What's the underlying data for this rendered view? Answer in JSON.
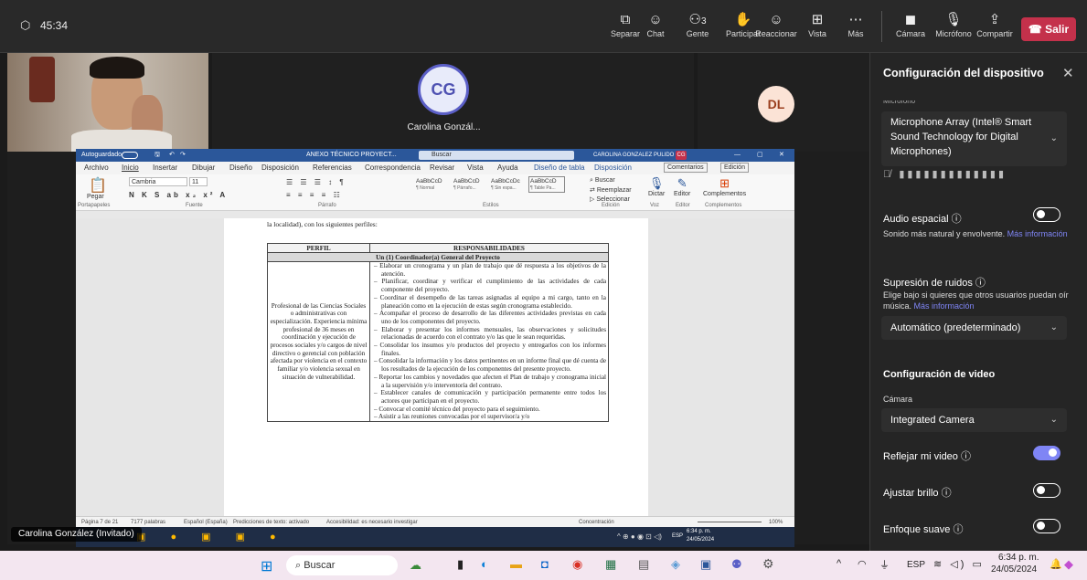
{
  "meeting": {
    "timer": "45:34",
    "toolbar": [
      {
        "label": "Separar",
        "icon": "popout-icon"
      },
      {
        "label": "Chat",
        "icon": "chat-icon"
      },
      {
        "label": "Gente",
        "icon": "people-icon",
        "count": "3"
      },
      {
        "label": "Participar",
        "icon": "hand-icon"
      },
      {
        "label": "Reaccionar",
        "icon": "smile-icon"
      },
      {
        "label": "Vista",
        "icon": "grid-icon"
      },
      {
        "label": "Más",
        "icon": "more-icon"
      }
    ],
    "camera_label": "Cámara",
    "mic_label": "Micrófono",
    "share_label": "Compartir",
    "leave_label": "Salir"
  },
  "participants": {
    "cg_initials": "CG",
    "cg_name": "Carolina Gonzál...",
    "dl_initials": "DL",
    "presenter": "Carolina González (Invitado)"
  },
  "word": {
    "autosave": "Autoguardado",
    "doc_title": "ANEXO TÉCNICO PROYECT...",
    "search": "Buscar",
    "user": "CAROLINA GONZALEZ PULIDO",
    "user_initials": "CG",
    "menu": [
      "Archivo",
      "Inicio",
      "Insertar",
      "Dibujar",
      "Diseño",
      "Disposición",
      "Referencias",
      "Correspondencia",
      "Revisar",
      "Vista",
      "Ayuda",
      "Diseño de tabla",
      "Disposición"
    ],
    "comments": "Comentarios",
    "editing": "Edición",
    "font_name": "Cambria",
    "font_size": "11",
    "styles": [
      "AaBbCcD",
      "AaBbCcD",
      "AaBbCcDc",
      "AaBbCcD"
    ],
    "style_names": [
      "¶ Normal",
      "¶ Párrafo...",
      "¶ Sin espa...",
      "¶ Table Pa..."
    ],
    "groups": [
      "Portapapeles",
      "Fuente",
      "Párrafo",
      "Estilos",
      "Edición",
      "Voz",
      "Editor",
      "Complementos"
    ],
    "find": "Buscar",
    "replace": "Reemplazar",
    "select": "Seleccionar",
    "dictate": "Dictar",
    "editor": "Editor",
    "addins": "Complementos",
    "paste": "Pegar",
    "intro": "la localidad), con los siguientes perfiles:",
    "th_perfil": "PERFIL",
    "th_resp": "RESPONSABILIDADES",
    "subheader": "Un (1) Coordinador(a) General del Proyecto",
    "perfil": "Profesional de las Ciencias Sociales o administrativas con especialización. Experiencia mínima profesional de 36 meses en coordinación y ejecución de procesos sociales y/o cargos de nivel directivo o gerencial con población afectada por violencia en el contexto familiar y/o violencia sexual en situación de vulnerabilidad.",
    "responsibilities": [
      "Elaborar un cronograma y un plan de trabajo que dé respuesta a los objetivos de la atención.",
      "Planificar, coordinar y verificar el cumplimiento de las actividades de cada componente del proyecto.",
      "Coordinar el desempeño de las tareas asignadas al equipo a mi cargo, tanto en la planeación como en la ejecución de estas según cronograma establecido.",
      "Acompañar el proceso de desarrollo de las diferentes actividades previstas en cada uno de los componentes del proyecto.",
      "Elaborar y presentar los informes mensuales, las observaciones y solicitudes relacionadas de acuerdo con el contrato y/o las que le sean requeridas.",
      "Consolidar los insumos y/o productos del proyecto y entregarlos con los informes finales.",
      "Consolidar la información y los datos pertinentes en un informe final que dé cuenta de los resultados de la ejecución de los componentes del presente proyecto.",
      "Reportar los cambios y novedades que afecten el Plan de trabajo y cronograma inicial a la supervisión y/o interventoría del contrato.",
      "Establecer canales de comunicación y participación permanente entre todos los actores que participan en el proyecto.",
      "Convocar el comité técnico del proyecto para el seguimiento.",
      "Asistir a las reuniones convocadas por el supervisor/a y/o"
    ],
    "status_page": "Página 7 de 21",
    "status_words": "7177 palabras",
    "status_lang": "Español (España)",
    "status_pred": "Predicciones de texto: activado",
    "status_access": "Accesibilidad: es necesario investigar",
    "status_focus": "Concentración",
    "zoom": "100%"
  },
  "remote_taskbar": {
    "time": "6:34 p. m.",
    "date": "24/05/2024",
    "lang": "ESP"
  },
  "panel": {
    "title": "Configuración del dispositivo",
    "mic_section": "Micrófono",
    "mic_device": "Microphone Array (Intel® Smart Sound Technology for Digital Microphones)",
    "spatial": "Audio espacial",
    "spatial_desc": "Sonido más natural y envolvente.",
    "spatial_link": "Más información",
    "noise": "Supresión de ruidos",
    "noise_desc": "Elige bajo si quieres que otros usuarios puedan oír música.",
    "noise_link": "Más información",
    "noise_value": "Automático (predeterminado)",
    "video_section": "Configuración de video",
    "camera_label": "Cámara",
    "camera_value": "Integrated Camera",
    "mirror": "Reflejar mi video",
    "brightness": "Ajustar brillo",
    "soft_focus": "Enfoque suave",
    "toggles": {
      "spatial": false,
      "mirror": true,
      "brightness": false,
      "soft_focus": false
    }
  },
  "taskbar": {
    "search": "Buscar",
    "lang": "ESP",
    "time": "6:34 p. m.",
    "date": "24/05/2024"
  }
}
